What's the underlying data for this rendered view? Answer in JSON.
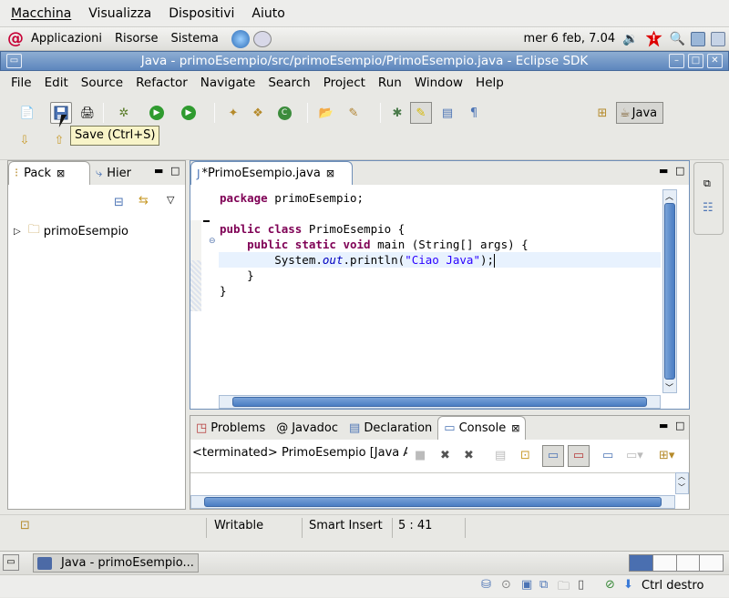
{
  "vbox_menu": [
    "Macchina",
    "Visualizza",
    "Dispositivi",
    "Aiuto"
  ],
  "gnome_panel": {
    "items": [
      "Applicazioni",
      "Risorse",
      "Sistema"
    ],
    "clock": "mer  6 feb, 7.04"
  },
  "window": {
    "title": "Java - primoEsempio/src/primoEsempio/PrimoEsempio.java - Eclipse SDK"
  },
  "menu": [
    "File",
    "Edit",
    "Source",
    "Refactor",
    "Navigate",
    "Search",
    "Project",
    "Run",
    "Window",
    "Help"
  ],
  "toolbar": {
    "tooltip": "Save (Ctrl+S)",
    "perspective": "Java"
  },
  "left_panel": {
    "tabs": [
      "Pack",
      "Hier"
    ],
    "tree_item": "primoEsempio"
  },
  "editor": {
    "tab": "*PrimoEsempio.java",
    "lines": [
      [
        {
          "t": "package",
          "c": "kw"
        },
        {
          "t": " primoEsempio;",
          "c": ""
        }
      ],
      [],
      [
        {
          "t": "public",
          "c": "kw"
        },
        {
          "t": " ",
          "c": ""
        },
        {
          "t": "class",
          "c": "kw"
        },
        {
          "t": " PrimoEsempio {",
          "c": ""
        }
      ],
      [
        {
          "t": "    ",
          "c": ""
        },
        {
          "t": "public",
          "c": "kw"
        },
        {
          "t": " ",
          "c": ""
        },
        {
          "t": "static",
          "c": "kw"
        },
        {
          "t": " ",
          "c": ""
        },
        {
          "t": "void",
          "c": "kw"
        },
        {
          "t": " main (String[] args) {",
          "c": ""
        }
      ],
      [
        {
          "t": "        System.",
          "c": ""
        },
        {
          "t": "out",
          "c": "it"
        },
        {
          "t": ".println(",
          "c": ""
        },
        {
          "t": "\"Ciao Java\"",
          "c": "str"
        },
        {
          "t": ");",
          "c": ""
        }
      ],
      [
        {
          "t": "    }",
          "c": ""
        }
      ],
      [
        {
          "t": "}",
          "c": ""
        }
      ]
    ]
  },
  "bottom_panel": {
    "tabs": [
      "Problems",
      "Javadoc",
      "Declaration",
      "Console"
    ],
    "console_header": "<terminated> PrimoEsempio [Java A"
  },
  "status": {
    "writable": "Writable",
    "insert": "Smart Insert",
    "position": "5 : 41"
  },
  "taskbar": {
    "task": "Java - primoEsempio..."
  },
  "vbox_status": {
    "host_key": "Ctrl destro"
  }
}
